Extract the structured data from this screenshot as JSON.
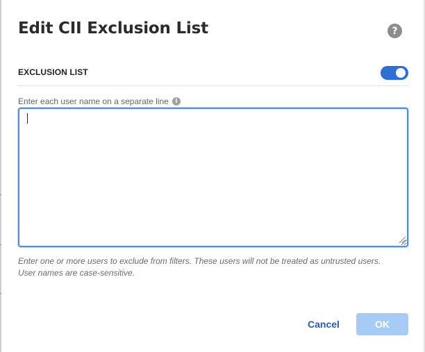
{
  "dialog": {
    "title": "Edit CII Exclusion List",
    "help_icon": "question-circle-icon",
    "help_glyph": "?"
  },
  "exclusion_list": {
    "label": "EXCLUSION LIST",
    "toggle_state": "on",
    "toggle_color": "#2d6fd6"
  },
  "field": {
    "label": "Enter each user name on a separate line",
    "info_icon": "info-circle-icon",
    "info_glyph": "i",
    "value": ""
  },
  "help_text": {
    "line1": "Enter one or more users to exclude from filters. These users will not be treated as untrusted users.",
    "line2": "User names are case-sensitive."
  },
  "actions": {
    "cancel_label": "Cancel",
    "ok_label": "OK",
    "ok_enabled": false
  },
  "colors": {
    "accent": "#1f5fbf",
    "ok_disabled_bg": "#a6ccf5",
    "focus_border": "#4d8fe0"
  }
}
